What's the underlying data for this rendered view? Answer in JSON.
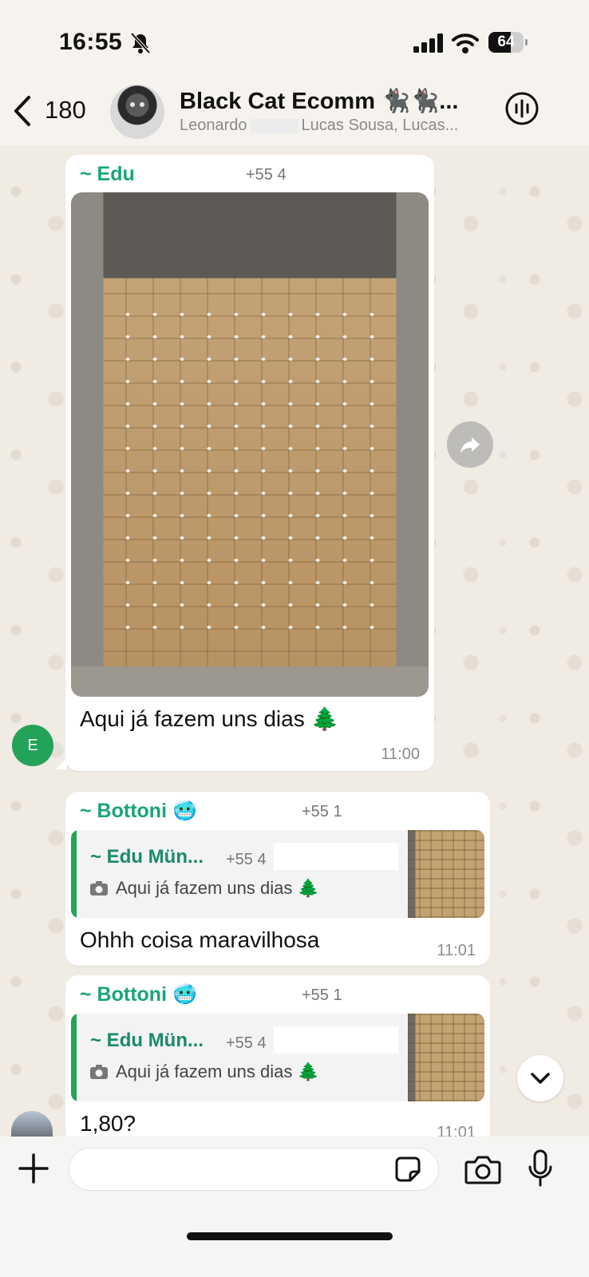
{
  "status_bar": {
    "time": "16:55",
    "battery": "64",
    "battery_level": 0.64,
    "icons": [
      "bell-slash-icon",
      "signal-icon",
      "wifi-icon",
      "battery-icon"
    ]
  },
  "header": {
    "back_count": "180",
    "title": "Black Cat Ecomm 🐈‍⬛🐈‍⬛...",
    "subtitle_left": "Leonardo",
    "subtitle_right": "Lucas Sousa, Lucas...",
    "icons": [
      "back-chevron-icon",
      "group-avatar",
      "group-call-icon"
    ]
  },
  "messages": [
    {
      "sender": "~ Edu",
      "phone": "+55 4",
      "has_photo": true,
      "text": "Aqui já fazem uns dias 🌲",
      "time": "11:00",
      "avatar_letter": "E"
    },
    {
      "sender": "~ Bottoni 🥶",
      "phone": "+55 1",
      "quote": {
        "sender": "~ Edu Mün...",
        "phone": "+55 4",
        "text": "Aqui já fazem uns dias 🌲"
      },
      "text": "Ohhh coisa maravilhosa",
      "time": "11:01"
    },
    {
      "sender": "~ Bottoni 🥶",
      "phone": "+55 1",
      "quote": {
        "sender": "~ Edu Mün...",
        "phone": "+55 4",
        "text": "Aqui já fazem uns dias 🌲"
      },
      "text": "1,80?",
      "time": "11:01"
    }
  ],
  "composer": {
    "placeholder": "",
    "icons": [
      "plus-icon",
      "sticker-icon",
      "camera-icon",
      "microphone-icon"
    ]
  },
  "colors": {
    "sender_green": "#1aa47a",
    "quote_bar": "#25a35a",
    "avatar_green": "#23a35a",
    "wallpaper": "#efeae2"
  }
}
